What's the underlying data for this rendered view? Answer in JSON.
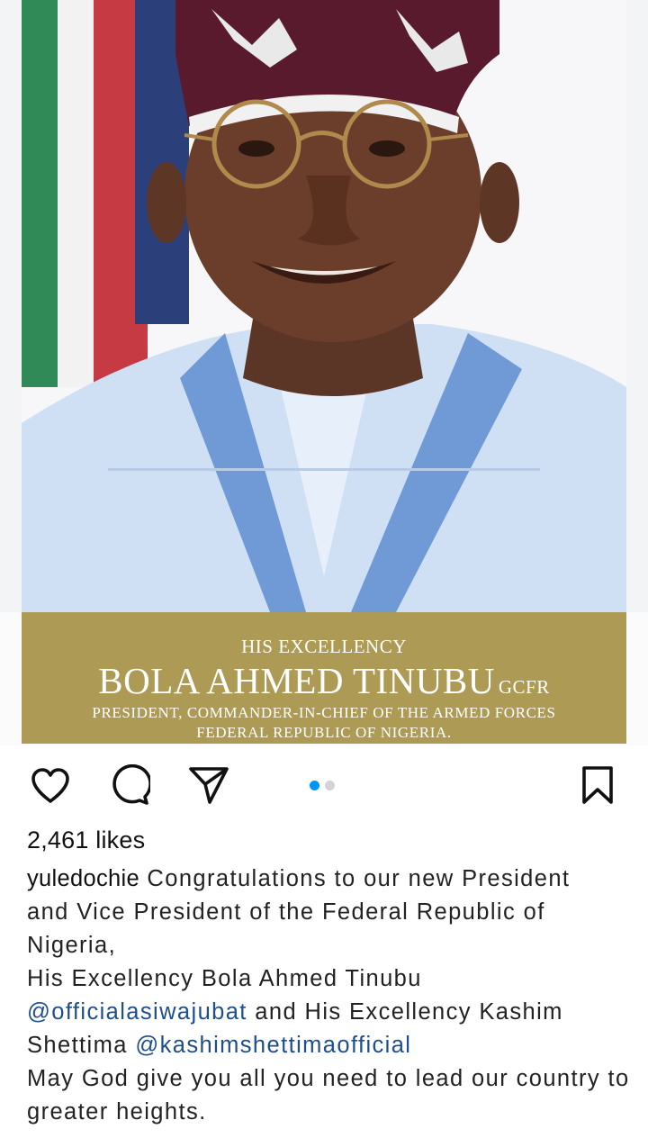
{
  "post": {
    "banner": {
      "kicker": "HIS EXCELLENCY",
      "name": "BOLA AHMED TINUBU",
      "name_suffix": "GCFR",
      "subtitle_line1": "PRESIDENT, COMMANDER-IN-CHIEF OF THE ARMED FORCES",
      "subtitle_line2": "FEDERAL REPUBLIC OF NIGERIA."
    },
    "carousel": {
      "count": 2,
      "active": 1
    }
  },
  "actions": {
    "like_icon": "heart-icon",
    "comment_icon": "comment-icon",
    "share_icon": "send-icon",
    "save_icon": "bookmark-icon"
  },
  "likes_text": "2,461 likes",
  "caption": {
    "username": "yuledochie",
    "line1": "Congratulations to our new President",
    "line2": "and Vice President of the Federal Republic of",
    "line3": "Nigeria,",
    "line4": "His Excellency Bola Ahmed Tinubu",
    "mention1": "@officialasiwajubat",
    "line5_rest": " and His Excellency Kashim",
    "line6_start": "Shettima ",
    "mention2": "@kashimshettimaofficial",
    "line7": "May God give you all you need to lead our country to",
    "line8": "greater heights."
  },
  "colors": {
    "banner": "#ad9a55",
    "mention": "#1e4f8c",
    "carousel_active": "#0095f6"
  }
}
